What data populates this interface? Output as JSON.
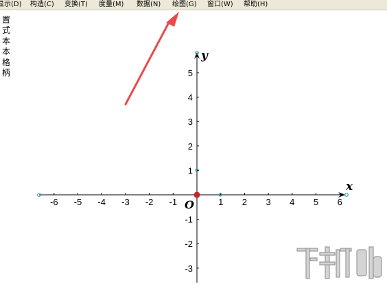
{
  "menu": {
    "items": [
      {
        "label": "显示(D)",
        "hotkey": "D"
      },
      {
        "label": "构造(C)",
        "hotkey": "C"
      },
      {
        "label": "变换(T)",
        "hotkey": "T"
      },
      {
        "label": "度量(M)",
        "hotkey": "M"
      },
      {
        "label": "数据(N)",
        "hotkey": "N"
      },
      {
        "label": "绘图(G)",
        "hotkey": "G"
      },
      {
        "label": "窗口(W)",
        "hotkey": "W"
      },
      {
        "label": "帮助(H)",
        "hotkey": "H"
      }
    ]
  },
  "sidebar": {
    "chars": [
      "置",
      "式",
      "本",
      "本",
      "格",
      "柄"
    ]
  },
  "graph": {
    "x_axis_label": "x",
    "y_axis_label": "y",
    "origin_label": "O",
    "x_ticks": [
      "-6",
      "-5",
      "-4",
      "-3",
      "-2",
      "-1",
      "1",
      "2",
      "3",
      "4",
      "5",
      "6"
    ],
    "y_ticks": [
      "5",
      "4",
      "3",
      "2",
      "1",
      "-1",
      "-2",
      "-3"
    ],
    "colors": {
      "axis": "#000000",
      "point": "#2a9d9d",
      "origin_point": "#c0282d",
      "annotation_arrow": "#e84b4b"
    }
  },
  "watermark": {
    "text": "下载吧"
  }
}
